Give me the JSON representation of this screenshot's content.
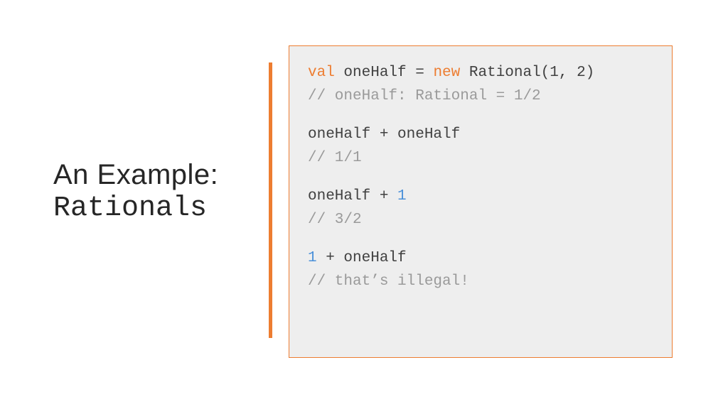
{
  "title": {
    "line1": "An Example:",
    "line2": "Rationals"
  },
  "colors": {
    "accent": "#ed7d31",
    "code_bg": "#eeeeee",
    "keyword": "#ed7d31",
    "number": "#4a90d9",
    "comment": "#9a9a9a"
  },
  "code": {
    "l1_kw1": "val",
    "l1_mid": " oneHalf = ",
    "l1_kw2": "new",
    "l1_end": " Rational(1, 2)",
    "l2": "// oneHalf: Rational = 1/2",
    "l3": "oneHalf + oneHalf",
    "l4": "// 1/1",
    "l5_pre": "oneHalf + ",
    "l5_num": "1",
    "l6": "// 3/2",
    "l7_num": "1",
    "l7_post": " + oneHalf",
    "l8": "// that’s illegal!"
  }
}
